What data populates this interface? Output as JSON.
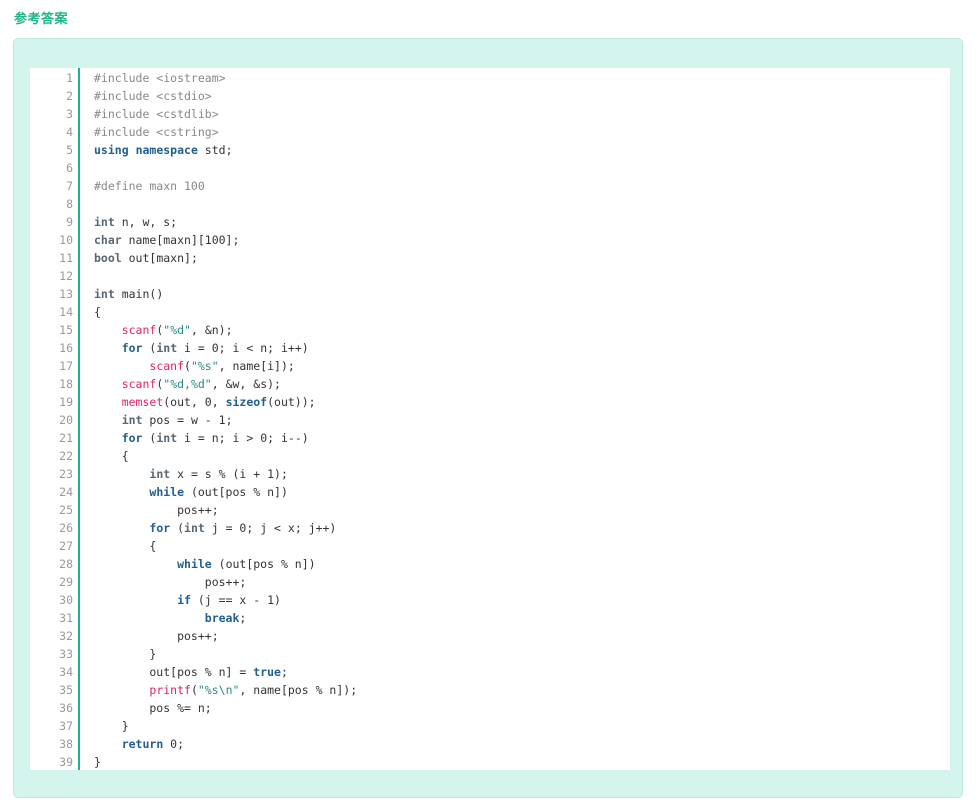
{
  "heading": "参考答案",
  "code": {
    "language": "cpp",
    "lines": [
      [
        {
          "t": "pp",
          "v": "#include <iostream>"
        }
      ],
      [
        {
          "t": "pp",
          "v": "#include <cstdio>"
        }
      ],
      [
        {
          "t": "pp",
          "v": "#include <cstdlib>"
        }
      ],
      [
        {
          "t": "pp",
          "v": "#include <cstring>"
        }
      ],
      [
        {
          "t": "kw",
          "v": "using"
        },
        {
          "t": "plain",
          "v": " "
        },
        {
          "t": "kw",
          "v": "namespace"
        },
        {
          "t": "plain",
          "v": " std;"
        }
      ],
      [],
      [
        {
          "t": "pp",
          "v": "#define maxn 100"
        }
      ],
      [],
      [
        {
          "t": "type",
          "v": "int"
        },
        {
          "t": "plain",
          "v": " n, w, s;"
        }
      ],
      [
        {
          "t": "type",
          "v": "char"
        },
        {
          "t": "plain",
          "v": " name[maxn][100];"
        }
      ],
      [
        {
          "t": "type",
          "v": "bool"
        },
        {
          "t": "plain",
          "v": " out[maxn];"
        }
      ],
      [],
      [
        {
          "t": "type",
          "v": "int"
        },
        {
          "t": "plain",
          "v": " main()"
        }
      ],
      [
        {
          "t": "plain",
          "v": "{"
        }
      ],
      [
        {
          "t": "plain",
          "v": "    "
        },
        {
          "t": "fn",
          "v": "scanf"
        },
        {
          "t": "plain",
          "v": "("
        },
        {
          "t": "str",
          "v": "\"%d\""
        },
        {
          "t": "plain",
          "v": ", &n);"
        }
      ],
      [
        {
          "t": "plain",
          "v": "    "
        },
        {
          "t": "kw",
          "v": "for"
        },
        {
          "t": "plain",
          "v": " ("
        },
        {
          "t": "type",
          "v": "int"
        },
        {
          "t": "plain",
          "v": " i = 0; i < n; i++)"
        }
      ],
      [
        {
          "t": "plain",
          "v": "        "
        },
        {
          "t": "fn",
          "v": "scanf"
        },
        {
          "t": "plain",
          "v": "("
        },
        {
          "t": "str",
          "v": "\"%s\""
        },
        {
          "t": "plain",
          "v": ", name[i]);"
        }
      ],
      [
        {
          "t": "plain",
          "v": "    "
        },
        {
          "t": "fn",
          "v": "scanf"
        },
        {
          "t": "plain",
          "v": "("
        },
        {
          "t": "str",
          "v": "\"%d,%d\""
        },
        {
          "t": "plain",
          "v": ", &w, &s);"
        }
      ],
      [
        {
          "t": "plain",
          "v": "    "
        },
        {
          "t": "fn",
          "v": "memset"
        },
        {
          "t": "plain",
          "v": "(out, 0, "
        },
        {
          "t": "kw",
          "v": "sizeof"
        },
        {
          "t": "plain",
          "v": "(out));"
        }
      ],
      [
        {
          "t": "plain",
          "v": "    "
        },
        {
          "t": "type",
          "v": "int"
        },
        {
          "t": "plain",
          "v": " pos = w - 1;"
        }
      ],
      [
        {
          "t": "plain",
          "v": "    "
        },
        {
          "t": "kw",
          "v": "for"
        },
        {
          "t": "plain",
          "v": " ("
        },
        {
          "t": "type",
          "v": "int"
        },
        {
          "t": "plain",
          "v": " i = n; i > 0; i--)"
        }
      ],
      [
        {
          "t": "plain",
          "v": "    {"
        }
      ],
      [
        {
          "t": "plain",
          "v": "        "
        },
        {
          "t": "type",
          "v": "int"
        },
        {
          "t": "plain",
          "v": " x = s % (i + 1);"
        }
      ],
      [
        {
          "t": "plain",
          "v": "        "
        },
        {
          "t": "kw",
          "v": "while"
        },
        {
          "t": "plain",
          "v": " (out[pos % n])"
        }
      ],
      [
        {
          "t": "plain",
          "v": "            pos++;"
        }
      ],
      [
        {
          "t": "plain",
          "v": "        "
        },
        {
          "t": "kw",
          "v": "for"
        },
        {
          "t": "plain",
          "v": " ("
        },
        {
          "t": "type",
          "v": "int"
        },
        {
          "t": "plain",
          "v": " j = 0; j < x; j++)"
        }
      ],
      [
        {
          "t": "plain",
          "v": "        {"
        }
      ],
      [
        {
          "t": "plain",
          "v": "            "
        },
        {
          "t": "kw",
          "v": "while"
        },
        {
          "t": "plain",
          "v": " (out[pos % n])"
        }
      ],
      [
        {
          "t": "plain",
          "v": "                pos++;"
        }
      ],
      [
        {
          "t": "plain",
          "v": "            "
        },
        {
          "t": "kw",
          "v": "if"
        },
        {
          "t": "plain",
          "v": " (j == x - 1)"
        }
      ],
      [
        {
          "t": "plain",
          "v": "                "
        },
        {
          "t": "kw",
          "v": "break"
        },
        {
          "t": "plain",
          "v": ";"
        }
      ],
      [
        {
          "t": "plain",
          "v": "            pos++;"
        }
      ],
      [
        {
          "t": "plain",
          "v": "        }"
        }
      ],
      [
        {
          "t": "plain",
          "v": "        out[pos % n] = "
        },
        {
          "t": "kw",
          "v": "true"
        },
        {
          "t": "plain",
          "v": ";"
        }
      ],
      [
        {
          "t": "plain",
          "v": "        "
        },
        {
          "t": "fn",
          "v": "printf"
        },
        {
          "t": "plain",
          "v": "("
        },
        {
          "t": "str",
          "v": "\"%s\\n\""
        },
        {
          "t": "plain",
          "v": ", name[pos % n]);"
        }
      ],
      [
        {
          "t": "plain",
          "v": "        pos %= n;"
        }
      ],
      [
        {
          "t": "plain",
          "v": "    }"
        }
      ],
      [
        {
          "t": "plain",
          "v": "    "
        },
        {
          "t": "kw",
          "v": "return"
        },
        {
          "t": "plain",
          "v": " 0;"
        }
      ],
      [
        {
          "t": "plain",
          "v": "}"
        }
      ]
    ]
  },
  "colors": {
    "heading": "#1fb78a",
    "box_background": "#d4f4ee",
    "gutter_rule": "#1fb09a",
    "keyword": "#1f5f8f",
    "function": "#e0226b",
    "string": "#2a8a8a",
    "preprocessor": "#888888"
  }
}
